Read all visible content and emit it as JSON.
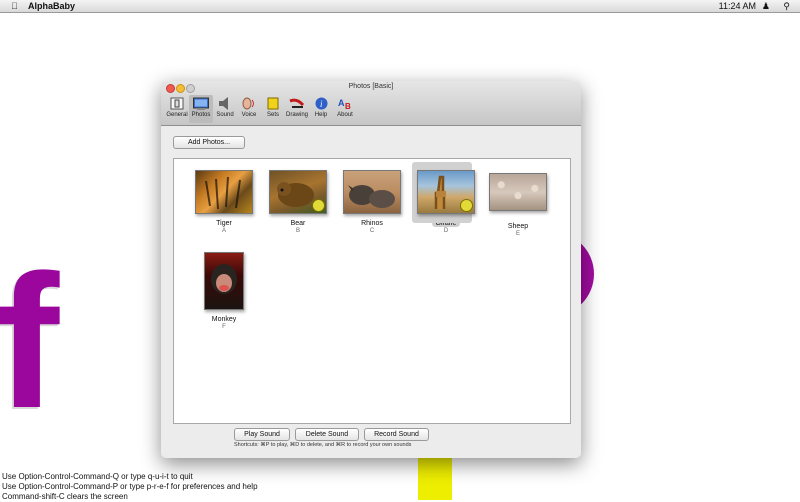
{
  "menubar": {
    "apple": "",
    "app_name": "AlphaBaby",
    "clock": "11:24 AM",
    "user_icon": "♟",
    "search_icon": "⚲"
  },
  "background": {
    "letter": "f",
    "purple": "#9b069c",
    "yellow": "#eeee00"
  },
  "hints": [
    "Use Option-Control-Command-Q or type q-u-i-t to quit",
    "Use Option-Control-Command-P or type p-r-e-f for preferences and help",
    "Command-shift-C clears the screen"
  ],
  "window": {
    "title": "Photos [Basic]",
    "toolbar": [
      {
        "label": "General",
        "icon": "general-icon"
      },
      {
        "label": "Photos",
        "icon": "photos-icon",
        "active": true
      },
      {
        "label": "Sound",
        "icon": "sound-icon"
      },
      {
        "label": "Voice",
        "icon": "voice-icon"
      },
      {
        "label": "Sets",
        "icon": "sets-icon"
      },
      {
        "label": "Drawing",
        "icon": "drawing-icon"
      },
      {
        "label": "Help",
        "icon": "help-icon"
      },
      {
        "label": "About",
        "icon": "about-icon"
      }
    ],
    "add_photos_label": "Add Photos...",
    "photos": [
      {
        "name": "Tiger",
        "letter": "A",
        "sound": false
      },
      {
        "name": "Bear",
        "letter": "B",
        "sound": true
      },
      {
        "name": "Rhinos",
        "letter": "C",
        "sound": false
      },
      {
        "name": "Giraffe",
        "letter": "D",
        "sound": true,
        "selected": true
      },
      {
        "name": "Sheep",
        "letter": "E",
        "sound": false
      },
      {
        "name": "Monkey",
        "letter": "F",
        "sound": false
      }
    ],
    "play_sound_label": "Play Sound",
    "delete_sound_label": "Delete Sound",
    "record_sound_label": "Record Sound",
    "shortcuts_text": "Shortcuts:  ⌘P to play, ⌘D to delete, and ⌘R to record your own sounds"
  }
}
